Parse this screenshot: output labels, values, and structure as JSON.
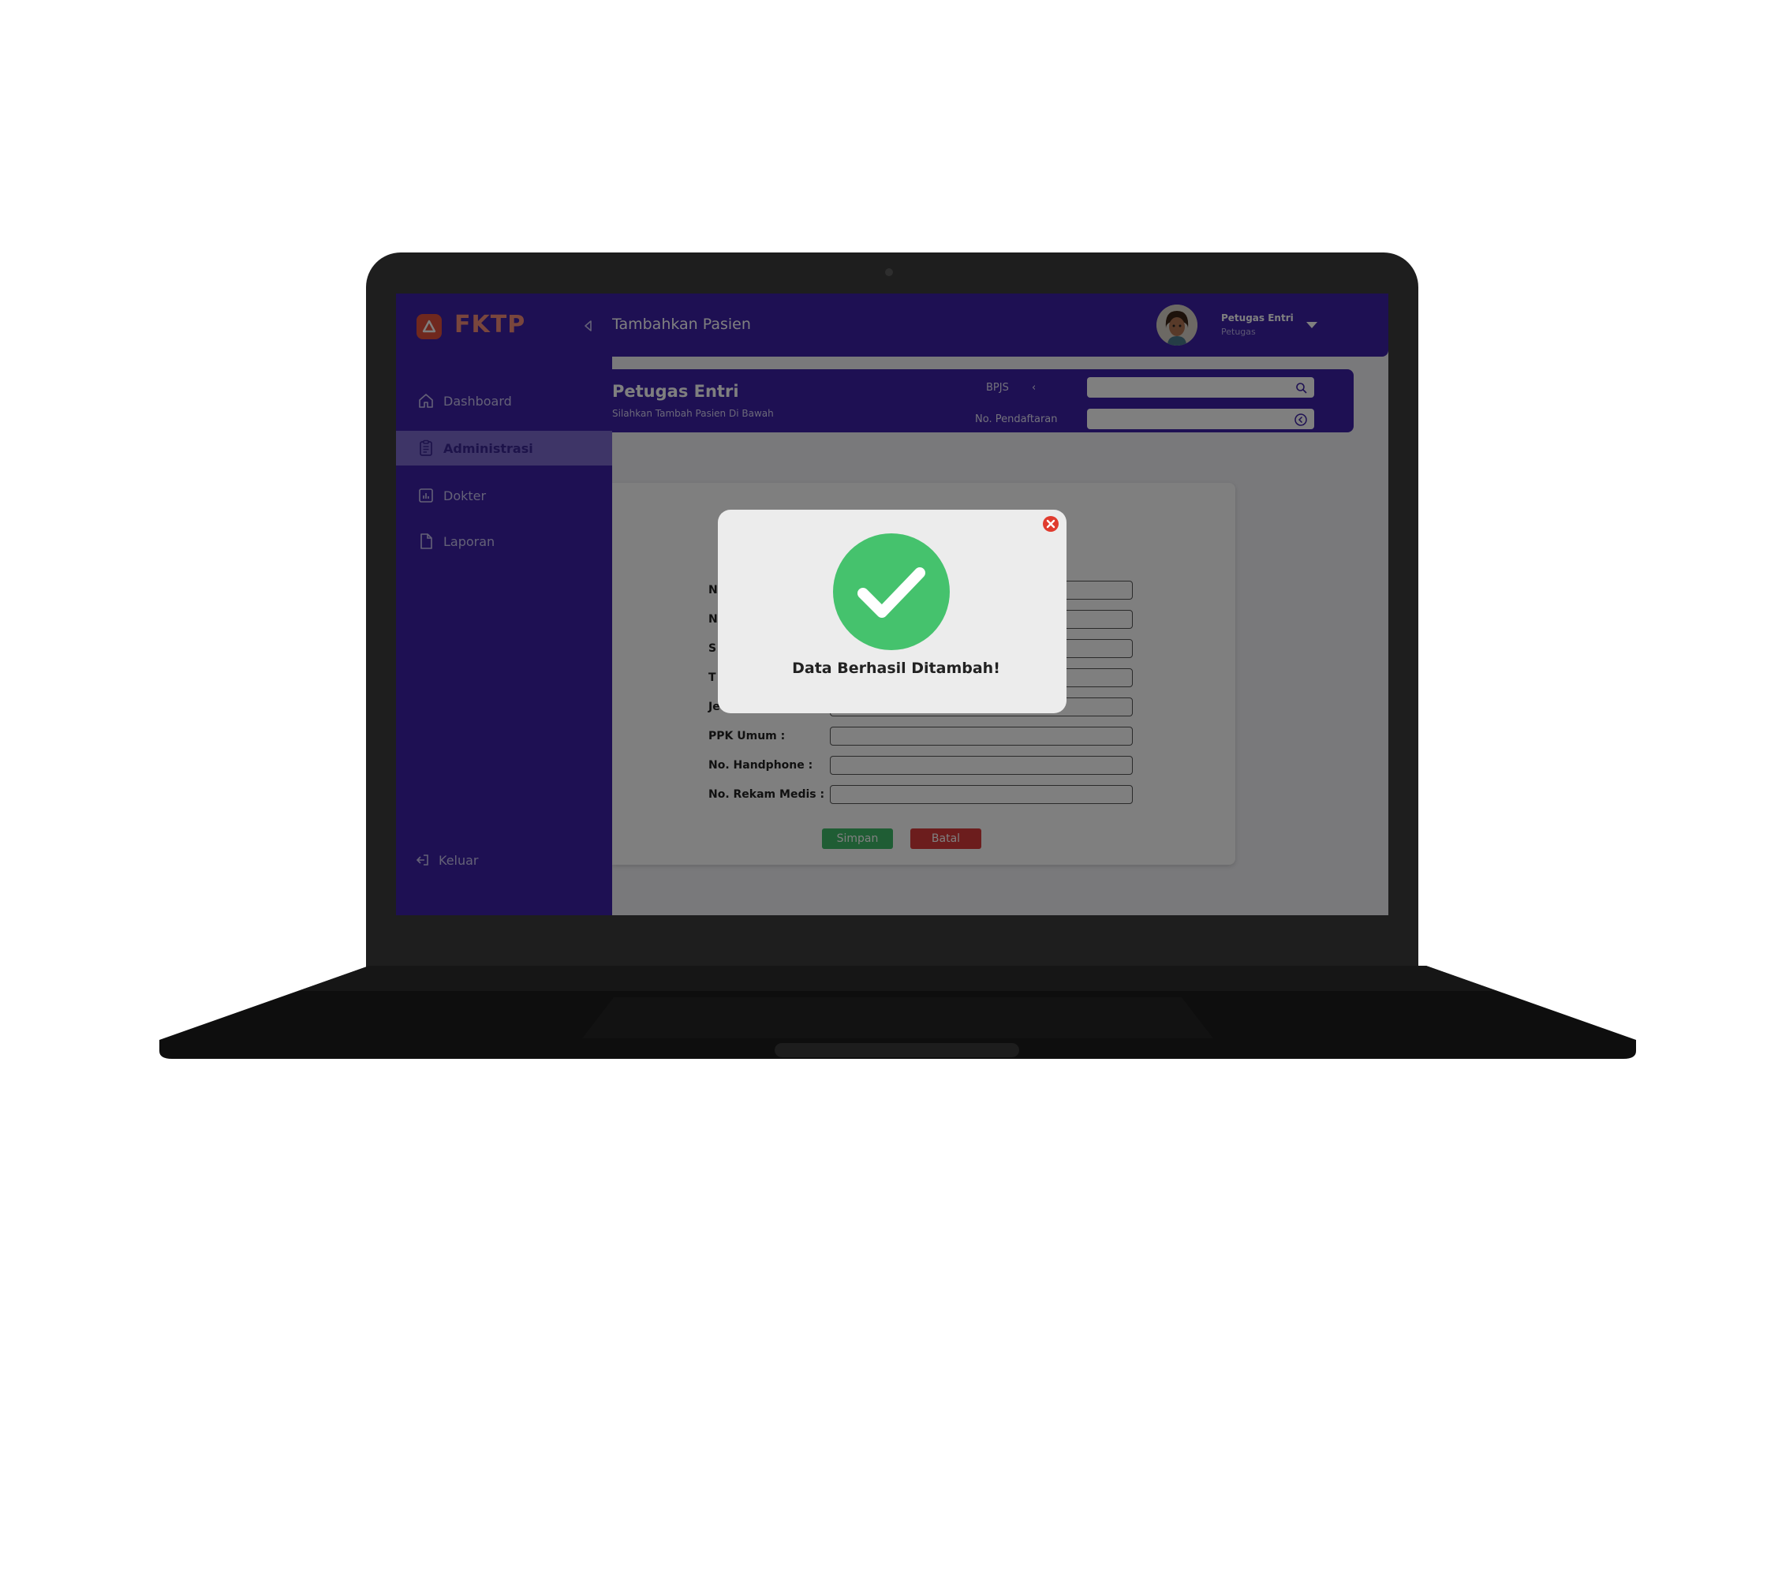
{
  "brand": {
    "name": "FKTP"
  },
  "header": {
    "page_title": "Tambahkan Pasien",
    "user_name": "Petugas Entri",
    "user_role": "Petugas"
  },
  "sidebar": {
    "items": [
      {
        "label": "Dashboard",
        "icon": "home-icon"
      },
      {
        "label": "Administrasi",
        "icon": "clipboard-icon",
        "active": true
      },
      {
        "label": "Dokter",
        "icon": "chart-icon"
      },
      {
        "label": "Laporan",
        "icon": "document-icon"
      }
    ],
    "logout_label": "Keluar"
  },
  "banner": {
    "title": "Petugas Entri",
    "subtitle": "Silahkan Tambah Pasien Di Bawah",
    "bpjs_label": "BPJS",
    "bpjs_value": "",
    "nopend_label": "No. Pendaftaran",
    "nopend_value": ""
  },
  "form": {
    "fields": [
      {
        "label": "N",
        "value": ""
      },
      {
        "label": "N",
        "value": ""
      },
      {
        "label": "S",
        "value": ""
      },
      {
        "label": "T",
        "value": ""
      },
      {
        "label": "Je",
        "value": ""
      },
      {
        "label": "PPK Umum :",
        "value": ""
      },
      {
        "label": "No. Handphone :",
        "value": ""
      },
      {
        "label": "No. Rekam Medis :",
        "value": ""
      }
    ],
    "save_label": "Simpan",
    "cancel_label": "Batal"
  },
  "modal": {
    "message": "Data Berhasil Ditambah!",
    "icon": "check-circle-icon",
    "close_icon": "close-circle-icon"
  },
  "colors": {
    "primary": "#3c21a6",
    "success": "#3fba68",
    "danger": "#d83b3b",
    "brand": "#e0503c"
  }
}
